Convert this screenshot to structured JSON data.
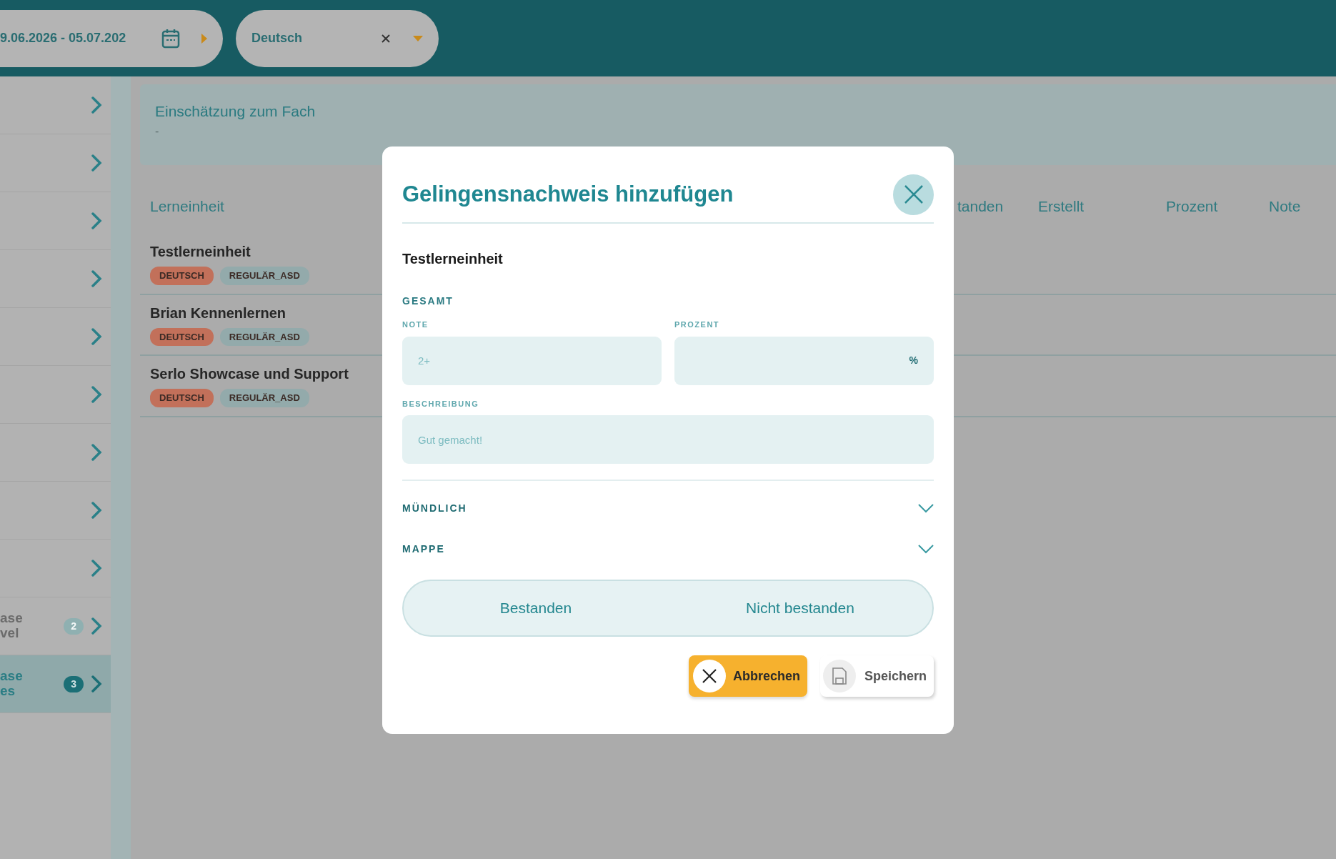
{
  "top_bar": {
    "date_range": {
      "value": "9.06.2026 - 05.07.202"
    },
    "language_filter": {
      "value": "Deutsch"
    }
  },
  "sidebar": {
    "items": [
      {
        "selected": false
      },
      {
        "selected": false
      },
      {
        "selected": false
      },
      {
        "selected": false
      },
      {
        "selected": false
      },
      {
        "selected": false
      },
      {
        "selected": false
      },
      {
        "selected": false
      },
      {
        "selected": false
      },
      {
        "lines": [
          "ase",
          "vel"
        ],
        "badge": "2",
        "selected": false
      },
      {
        "lines": [
          "ase",
          "es"
        ],
        "badge": "3",
        "selected": true
      }
    ]
  },
  "assessment": {
    "title": "Einschätzung zum Fach",
    "value": "-"
  },
  "table": {
    "columns": [
      "Lerneinheit",
      "tanden",
      "Erstellt",
      "Prozent",
      "Note"
    ],
    "rows": [
      {
        "title": "Testlerneinheit",
        "tags": [
          {
            "label": "DEUTSCH",
            "color": "#c2705a"
          },
          {
            "label": "REGULÄR_ASD",
            "color": "#93aaab"
          }
        ]
      },
      {
        "title": "Brian Kennenlernen",
        "tags": [
          {
            "label": "DEUTSCH",
            "color": "#c2705a"
          },
          {
            "label": "REGULÄR_ASD",
            "color": "#93aaab"
          }
        ]
      },
      {
        "title": "Serlo Showcase und Support",
        "tags": [
          {
            "label": "DEUTSCH",
            "color": "#c2705a"
          },
          {
            "label": "REGULÄR_ASD",
            "color": "#93aaab"
          }
        ]
      }
    ]
  },
  "modal": {
    "title": "Gelingensnachweis hinzufügen",
    "unit": "Testlerneinheit",
    "section": "GESAMT",
    "fields": [
      {
        "label": "NOTE",
        "placeholder": "2+"
      },
      {
        "label": "PROZENT",
        "suffix": "%"
      }
    ],
    "description": {
      "label": "BESCHREIBUNG",
      "placeholder": "Gut gemacht!"
    },
    "sections": [
      {
        "label": "MÜNDLICH",
        "expanded": false
      },
      {
        "label": "MAPPE",
        "expanded": false
      }
    ],
    "result_options": [
      {
        "label": "Bestanden",
        "selected": false
      },
      {
        "label": "Nicht bestanden",
        "selected": false
      }
    ],
    "buttons": [
      {
        "label": "Abbrechen",
        "kind": "cancel"
      },
      {
        "label": "Speichern",
        "kind": "save"
      }
    ]
  }
}
